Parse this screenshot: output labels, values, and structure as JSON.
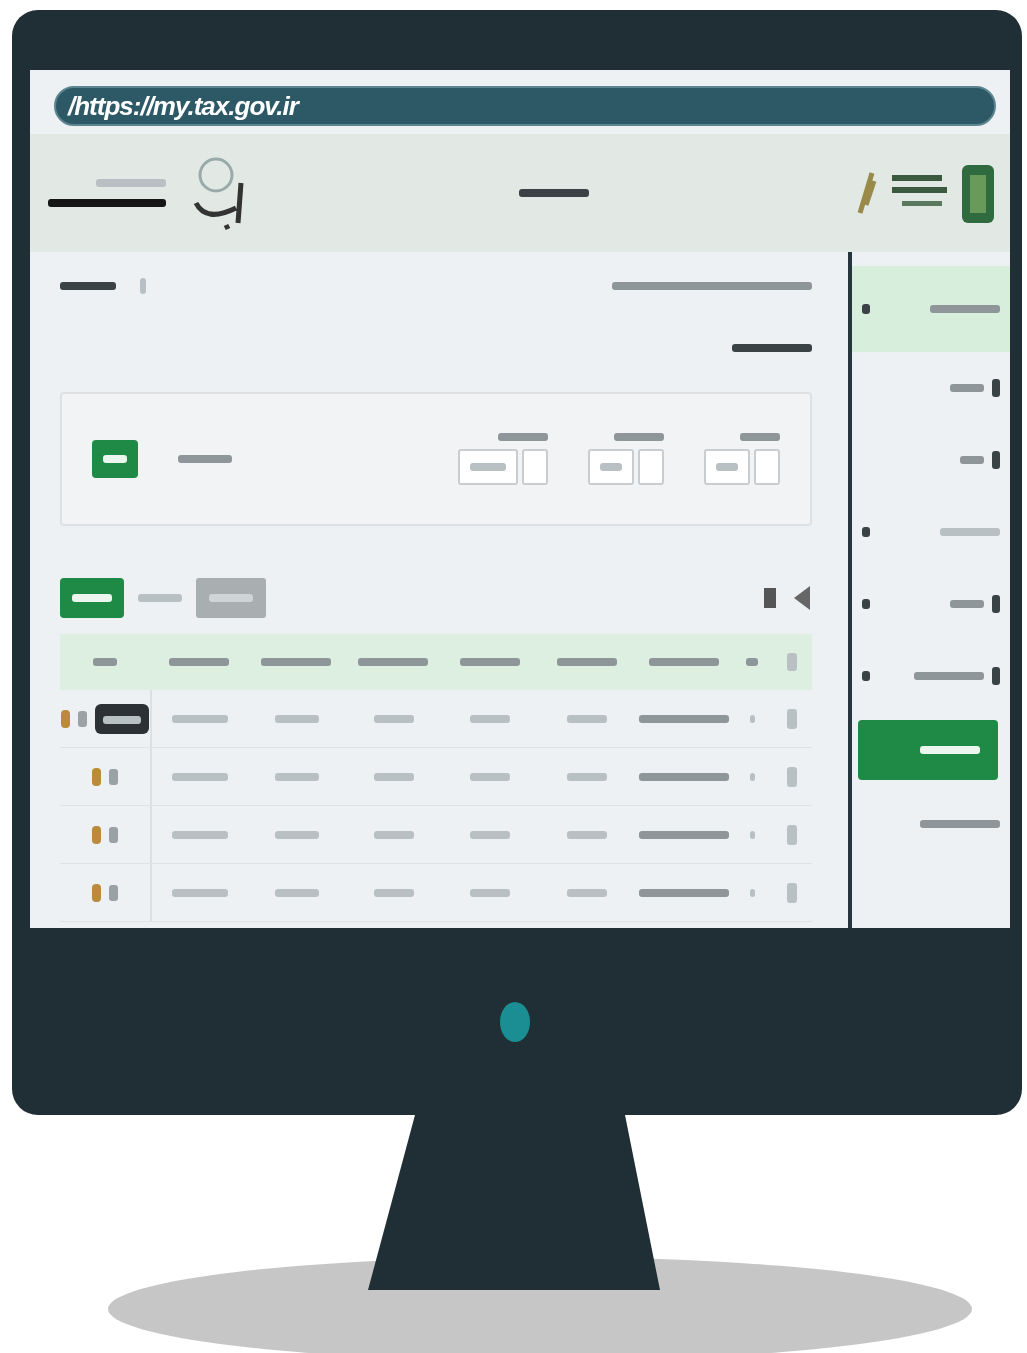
{
  "browser": {
    "url": "/https://my.tax.gov.ir"
  },
  "sidebar": {
    "items": [
      {
        "selected": true
      },
      {
        "selected": false
      },
      {
        "selected": false
      },
      {
        "selected": false
      },
      {
        "selected": false
      },
      {
        "selected": false
      }
    ]
  }
}
